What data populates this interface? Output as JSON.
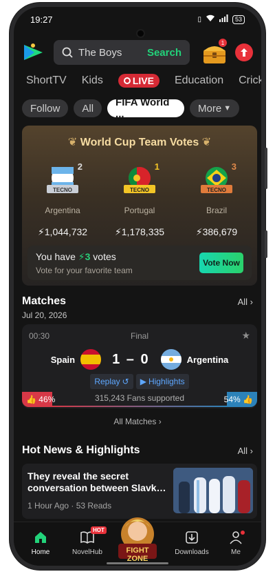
{
  "status_bar": {
    "time": "19:27",
    "battery": "53"
  },
  "header": {
    "search_placeholder": "The Boys",
    "search_button": "Search",
    "chest_badge": "1"
  },
  "categories": [
    "ShortTV",
    "Kids",
    "LIVE",
    "Education",
    "Cricket"
  ],
  "filters": [
    "Follow",
    "All",
    "FIFA World ...",
    "More"
  ],
  "vote_card": {
    "title": "World Cup Team Votes",
    "teams": [
      {
        "rank": "2",
        "name": "Argentina",
        "votes": "1,044,732",
        "brand": "TECNO"
      },
      {
        "rank": "1",
        "name": "Portugal",
        "votes": "1,178,335",
        "brand": "TECNO"
      },
      {
        "rank": "3",
        "name": "Brazil",
        "votes": "386,679",
        "brand": "TECNO"
      }
    ],
    "you_have_prefix": "You have",
    "you_have_count": "3",
    "you_have_suffix": "votes",
    "subtitle": "Vote for your favorite team",
    "button": "Vote Now"
  },
  "matches": {
    "title": "Matches",
    "all_label": "All",
    "date": "Jul 20, 2026",
    "match": {
      "time": "00:30",
      "status": "Final",
      "home": "Spain",
      "away": "Argentina",
      "score": "1 – 0",
      "replay": "Replay",
      "highlights": "Highlights",
      "home_pct": "46%",
      "away_pct": "54%",
      "home_share": 0.46,
      "fans": "315,243 Fans supported"
    },
    "all_matches": "All Matches"
  },
  "news": {
    "title": "Hot News & Highlights",
    "all_label": "All",
    "item": {
      "title": "They reveal the secret conversation between Slavk…",
      "meta": "1 Hour Ago · 53 Reads"
    }
  },
  "bottom_nav": [
    {
      "label": "Home"
    },
    {
      "label": "NovelHub",
      "badge": "HOT"
    },
    {
      "label": "FIGHT ZONE"
    },
    {
      "label": "Downloads"
    },
    {
      "label": "Me"
    }
  ],
  "colors": {
    "accent_green": "#22d37a",
    "live_red": "#d52a35",
    "home_red": "#d73847",
    "away_blue": "#2c82b9"
  }
}
